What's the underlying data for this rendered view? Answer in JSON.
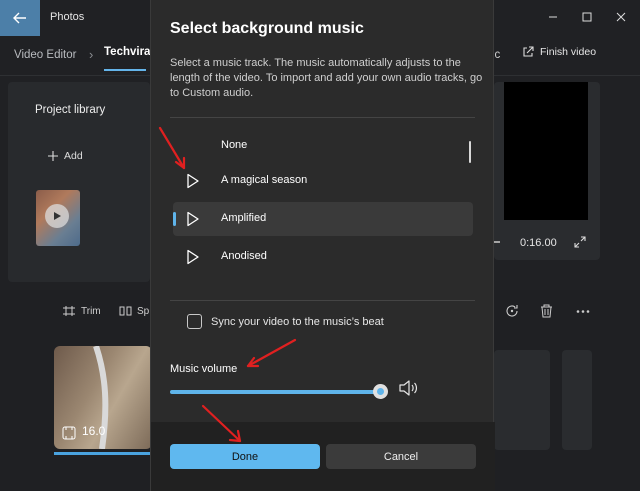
{
  "app": {
    "title": "Photos",
    "breadcrumb_root": "Video Editor",
    "breadcrumb_sep": "›",
    "breadcrumb_current": "Techviral",
    "toolbar_fragment": "ic",
    "finish_video": "Finish video"
  },
  "library": {
    "title": "Project library",
    "add_label": "Add"
  },
  "preview": {
    "time": "0:16.00"
  },
  "timeline": {
    "trim_label": "Trim",
    "split_label": "Sp",
    "clip_duration": "16.0"
  },
  "dialog": {
    "title": "Select background music",
    "description": "Select a music track. The music automatically adjusts to the length of the video. To import and add your own audio tracks, go to Custom audio.",
    "tracks": [
      {
        "label": "None",
        "play_icon": false
      },
      {
        "label": "A magical season",
        "play_icon": true
      },
      {
        "label": "Amplified",
        "play_icon": true,
        "selected": true
      },
      {
        "label": "Anodised",
        "play_icon": true
      }
    ],
    "sync_label": "Sync your video to the music’s beat",
    "sync_checked": false,
    "volume_label": "Music volume",
    "volume_level": 1.0,
    "done_label": "Done",
    "cancel_label": "Cancel"
  },
  "colors": {
    "accent": "#5fb8ef",
    "annotation_arrow": "#e02020"
  }
}
